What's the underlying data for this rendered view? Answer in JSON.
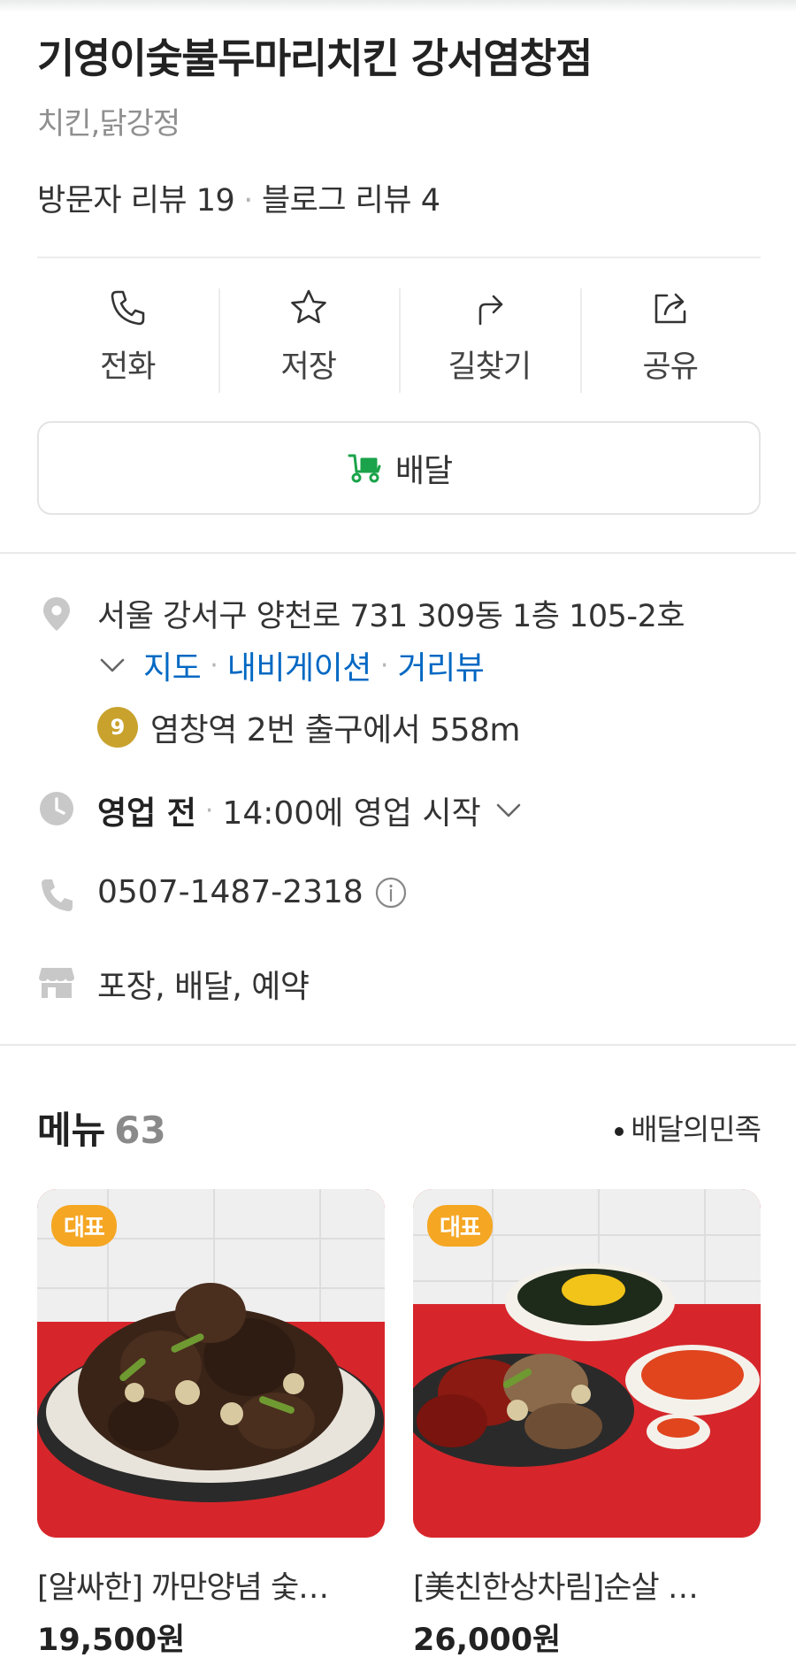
{
  "place": {
    "name": "기영이숯불두마리치킨 강서염창점",
    "category": "치킨,닭강정",
    "visitor_reviews": "방문자 리뷰 19",
    "blog_reviews": "블로그 리뷰 4",
    "review_sep": "·"
  },
  "actions": [
    {
      "label": "전화",
      "icon": "phone-icon"
    },
    {
      "label": "저장",
      "icon": "star-icon"
    },
    {
      "label": "길찾기",
      "icon": "directions-icon"
    },
    {
      "label": "공유",
      "icon": "share-icon"
    }
  ],
  "delivery": {
    "label": "배달",
    "icon": "delivery-scooter-icon"
  },
  "info": {
    "address": "서울 강서구 양천로 731 309동 1층 105-2호",
    "links": [
      "지도",
      "내비게이션",
      "거리뷰"
    ],
    "link_sep": "·",
    "subway_line": "9",
    "subway_text": "염창역 2번 출구에서 558m",
    "hours_status": "영업 전",
    "hours_detail": "14:00에 영업 시작",
    "phone": "0507-1487-2318",
    "services": "포장, 배달, 예약"
  },
  "menu": {
    "title": "메뉴",
    "count": "63",
    "source": "배달의민족",
    "items": [
      {
        "badge": "대표",
        "name": "[알싸한] 까만양념 숯…",
        "price": "19,500원"
      },
      {
        "badge": "대표",
        "name": "[美친한상차림]순살 …",
        "price": "26,000원"
      }
    ]
  },
  "colors": {
    "link": "#0068c3",
    "badge": "#f5a623",
    "subway": "#c8a22c",
    "delivery_green": "#1aa34a"
  }
}
